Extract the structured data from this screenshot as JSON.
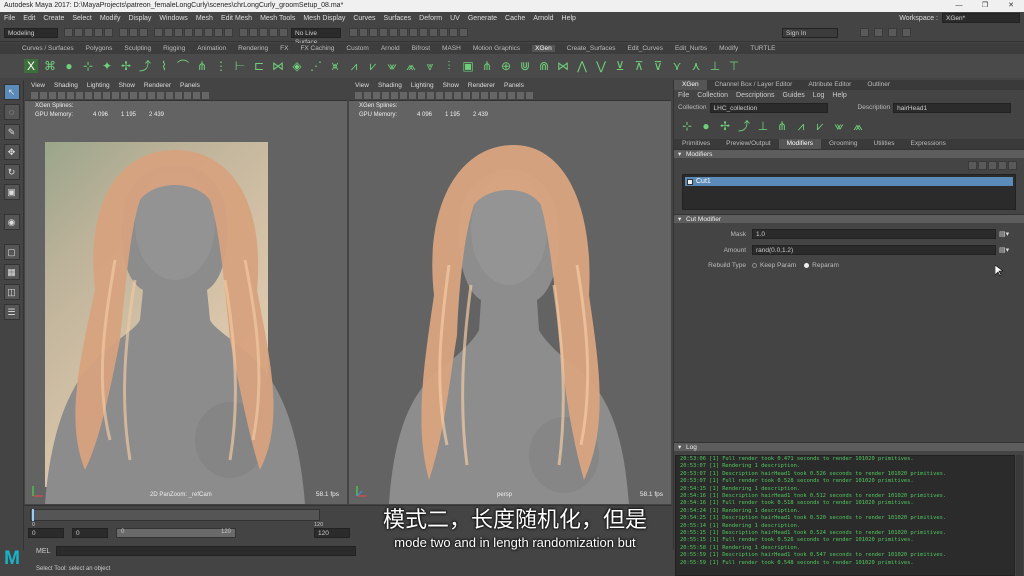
{
  "window": {
    "title": "Autodesk Maya 2017: D:\\MayaProjects\\patreon_femaleLongCurly\\scenes\\chrLongCurly_groomSetup_08.ma*",
    "min": "—",
    "max": "❐",
    "close": "✕"
  },
  "menubar": {
    "items": [
      "File",
      "Edit",
      "Create",
      "Select",
      "Modify",
      "Display",
      "Windows",
      "Mesh",
      "Edit Mesh",
      "Mesh Tools",
      "Mesh Display",
      "Curves",
      "Surfaces",
      "Deform",
      "UV",
      "Generate",
      "Cache",
      "Arnold",
      "Help"
    ],
    "workspace_label": "Workspace :",
    "workspace_value": "XGen*"
  },
  "statusline": {
    "mode": "Modeling",
    "live_surface": "No Live Surface",
    "sign_in": "Sign In"
  },
  "shelf": {
    "tabs": [
      "Curves / Surfaces",
      "Polygons",
      "Sculpting",
      "Rigging",
      "Animation",
      "Rendering",
      "FX",
      "FX Caching",
      "Custom",
      "Arnold",
      "Bifrost",
      "MASH",
      "Motion Graphics",
      "XGen",
      "Create_Surfaces",
      "Edit_Curves",
      "Edit_Nurbs",
      "Modify",
      "TURTLE"
    ],
    "active": "XGen"
  },
  "viewport_menu": [
    "View",
    "Shading",
    "Lighting",
    "Show",
    "Renderer",
    "Panels"
  ],
  "hud": {
    "splines_label": "XGen Splines:",
    "gpu_label": "GPU Memory:",
    "gpu_values": [
      "4 096",
      "1 195",
      "2 439"
    ]
  },
  "viewport_left": {
    "camera": "2D PanZoom: _refCam",
    "fps": "58.1 fps"
  },
  "viewport_right": {
    "camera": "persp",
    "fps": "58.1 fps"
  },
  "xgen": {
    "tabs": [
      "XGen",
      "Channel Box / Layer Editor",
      "Attribute Editor",
      "Outliner"
    ],
    "menu": [
      "File",
      "Collection",
      "Descriptions",
      "Guides",
      "Log",
      "Help"
    ],
    "collection_label": "Collection",
    "collection_value": "LHC_collection",
    "description_label": "Description",
    "description_value": "hairHead1",
    "subtabs": [
      "Primitives",
      "Preview/Output",
      "Modifiers",
      "Grooming",
      "Utilities",
      "Expressions"
    ],
    "active_subtab": "Modifiers",
    "modifiers_frame": "Modifiers",
    "modifier_item": "Cut1",
    "cut_frame": "Cut Modifier",
    "mask_label": "Mask",
    "mask_value": "1.0",
    "amount_label": "Amount",
    "amount_value": "rand(0.0,1.2)",
    "rebuild_label": "Rebuild Type",
    "keep_param": "Keep Param",
    "reparam": "Reparam"
  },
  "log": {
    "title": "Log",
    "lines": [
      "20:53:06 [1] Full render took 0.471 seconds to render 101020 primitives.",
      "20:53:07 [1] Rendering 1 description.",
      "20:53:07 [1] Description hairHead1 took 0.526 seconds to render 101020 primitives.",
      "20:53:07 [1] Full render took 0.528 seconds to render 101020 primitives.",
      "20:54:15 [1] Rendering 1 description.",
      "20:54:16 [1] Description hairHead1 took 0.512 seconds to render 101020 primitives.",
      "20:54:16 [1] Full render took 0.518 seconds to render 101020 primitives.",
      "20:54:24 [1] Rendering 1 description.",
      "20:54:25 [1] Description hairHead1 took 0.520 seconds to render 101020 primitives.",
      "20:55:14 [1] Rendering 1 description.",
      "20:55:15 [1] Description hairHead1 took 0.524 seconds to render 101020 primitives.",
      "20:55:15 [1] Full render took 0.526 seconds to render 101020 primitives.",
      "20:55:58 [1] Rendering 1 description.",
      "20:55:59 [1] Description hairHead1 took 0.547 seconds to render 101020 primitives.",
      "20:55:59 [1] Full render took 0.548 seconds to render 101020 primitives."
    ]
  },
  "timeline": {
    "start": "0",
    "end": "120",
    "range_start": "0",
    "range_inner_start": "0",
    "range_inner_end": "120",
    "range_end": "120",
    "char_set": "No Character Set"
  },
  "cmdline": {
    "label": "MEL"
  },
  "helpline": "Select Tool: select an object",
  "subtitle": {
    "zh": "模式二，长度随机化，但是",
    "en": "mode two and in length randomization but"
  },
  "colors": {
    "accent": "#5b8bb8",
    "log_text": "#52c85e",
    "logo": "#19b3c9"
  }
}
